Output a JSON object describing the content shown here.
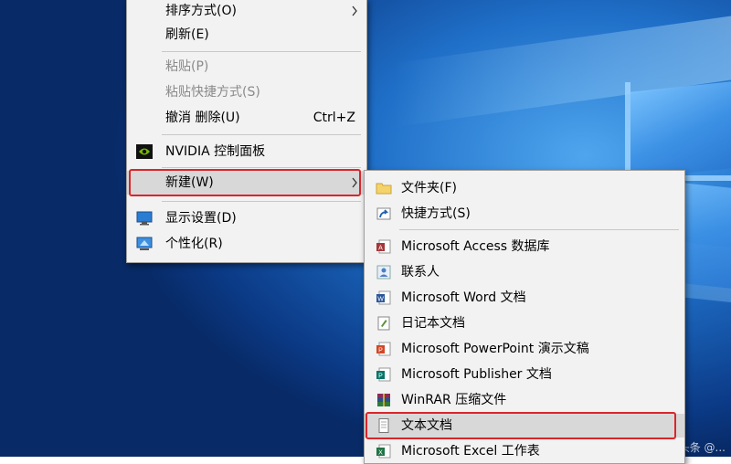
{
  "context_menu": {
    "items": [
      {
        "label": "排序方式(O)",
        "has_submenu": true
      },
      {
        "label": "刷新(E)"
      },
      {
        "label": "粘贴(P)",
        "disabled": true
      },
      {
        "label": "粘贴快捷方式(S)",
        "disabled": true
      },
      {
        "label": "撤消 删除(U)",
        "shortcut": "Ctrl+Z"
      },
      {
        "label": "NVIDIA 控制面板",
        "icon": "nvidia-icon"
      },
      {
        "label": "新建(W)",
        "has_submenu": true,
        "highlighted": true
      },
      {
        "label": "显示设置(D)",
        "icon": "display-settings-icon"
      },
      {
        "label": "个性化(R)",
        "icon": "personalize-icon"
      }
    ]
  },
  "new_submenu": {
    "items": [
      {
        "label": "文件夹(F)",
        "icon": "folder-icon"
      },
      {
        "label": "快捷方式(S)",
        "icon": "shortcut-icon"
      },
      {
        "label": "Microsoft Access 数据库",
        "icon": "access-icon"
      },
      {
        "label": "联系人",
        "icon": "contact-icon"
      },
      {
        "label": "Microsoft Word 文档",
        "icon": "word-icon"
      },
      {
        "label": "日记本文档",
        "icon": "journal-icon"
      },
      {
        "label": "Microsoft PowerPoint 演示文稿",
        "icon": "powerpoint-icon"
      },
      {
        "label": "Microsoft Publisher 文档",
        "icon": "publisher-icon"
      },
      {
        "label": "WinRAR 压缩文件",
        "icon": "winrar-icon"
      },
      {
        "label": "文本文档",
        "icon": "text-document-icon",
        "highlighted": true
      },
      {
        "label": "Microsoft Excel 工作表",
        "icon": "excel-icon"
      }
    ]
  },
  "colors": {
    "highlight_box": "#d9262b",
    "menu_bg": "#f2f2f2",
    "desktop_blue": "#1f6fc8"
  },
  "watermark": "头条 @..."
}
